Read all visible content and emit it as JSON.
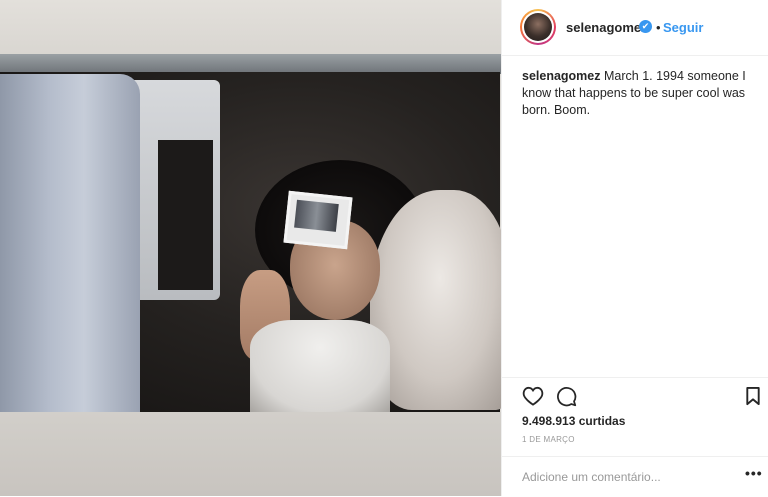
{
  "post": {
    "image_alt_objects": [
      "jeans",
      "window",
      "hair",
      "face",
      "polaroid",
      "fur",
      "shirt",
      "hand"
    ]
  },
  "header": {
    "username": "selenagomez",
    "verified_glyph": "✔",
    "separator": "•",
    "follow_label": "Seguir"
  },
  "caption": {
    "username": "selenagomez",
    "text": "March 1. 1994 someone I know that happens to be super cool was born. Boom."
  },
  "actions": {
    "icons": [
      "heart-icon",
      "comment-icon",
      "bookmark-icon"
    ]
  },
  "stats": {
    "likes": "9.498.913 curtidas",
    "date": "1 de março"
  },
  "comment": {
    "placeholder": "Adicione um comentário...",
    "more_label": "•••"
  },
  "colors": {
    "accent": "#3897f0",
    "text": "#262626",
    "muted": "#999999",
    "border": "#efefef"
  }
}
